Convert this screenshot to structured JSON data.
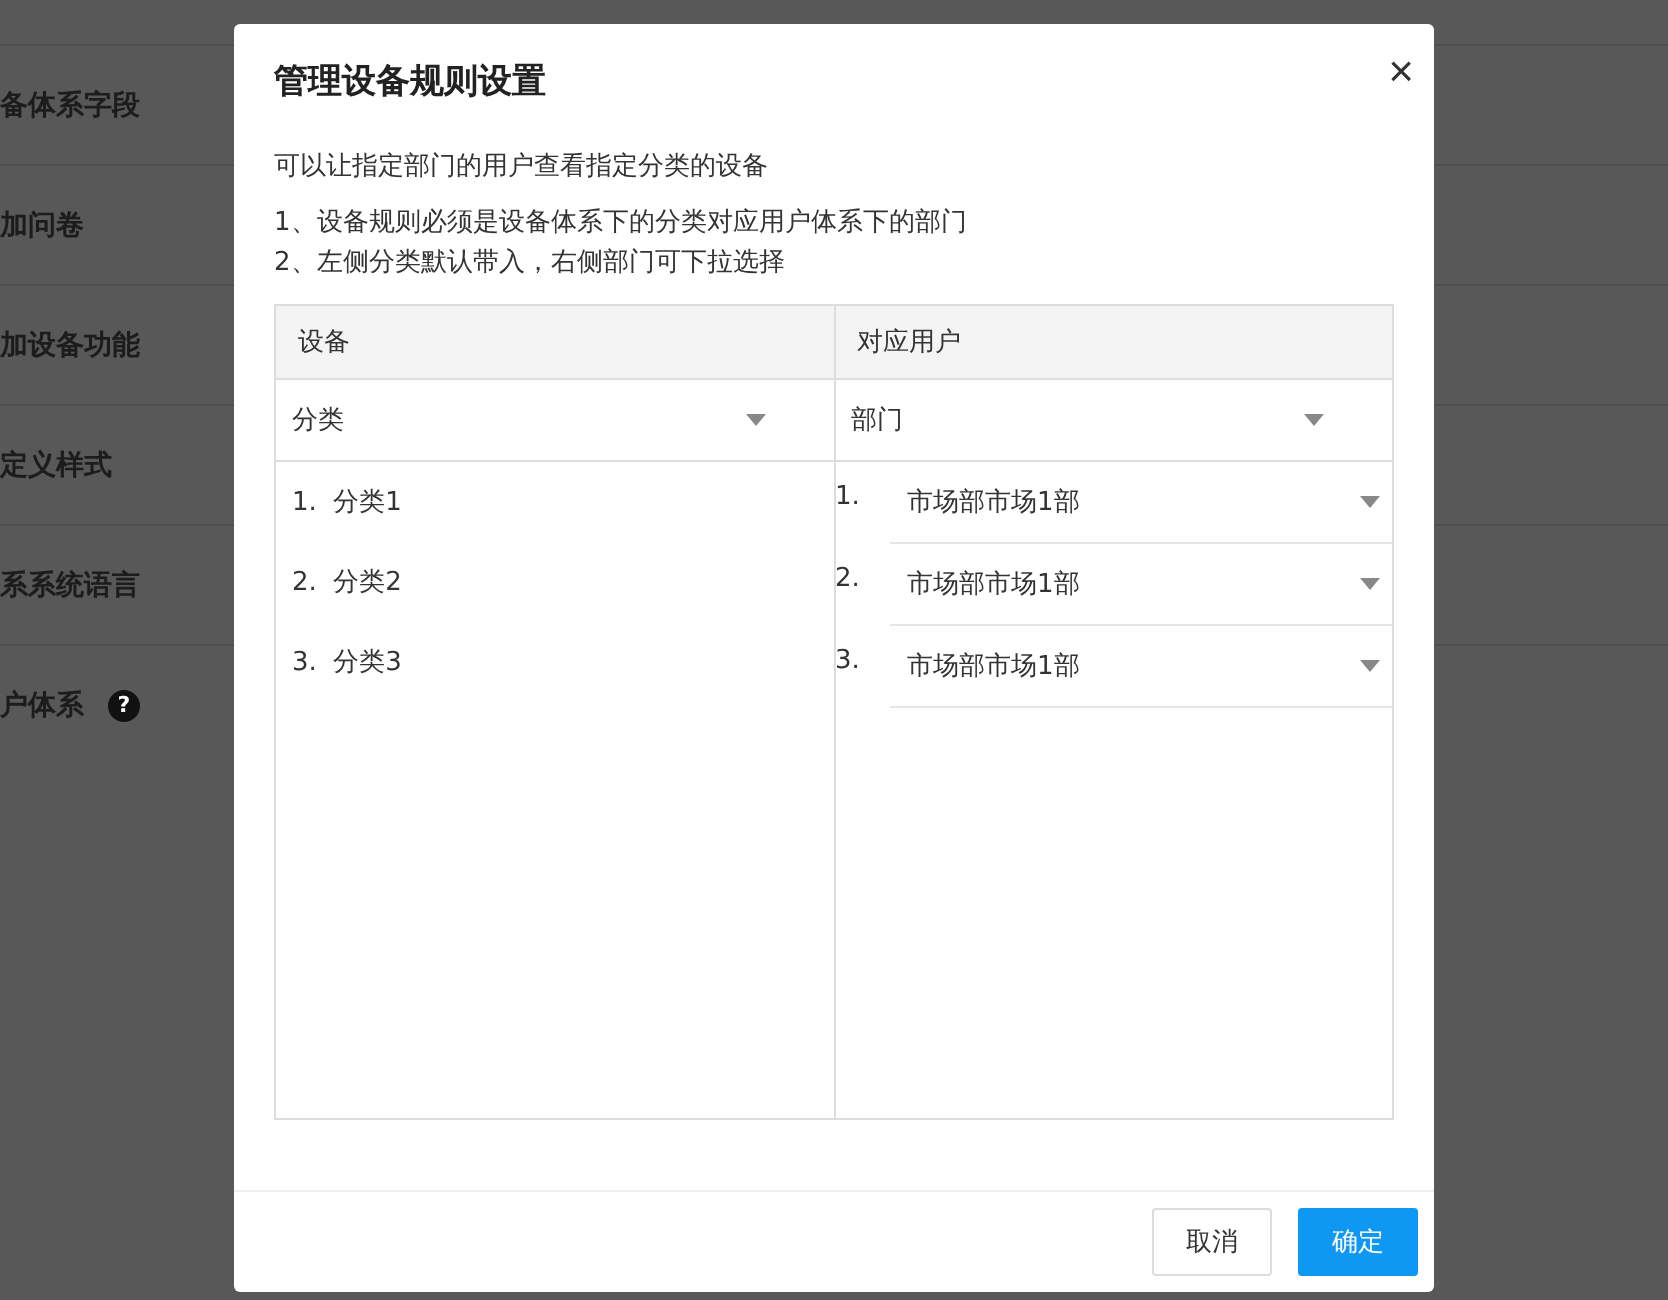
{
  "background": {
    "rows": [
      {
        "label": "备体系字段"
      },
      {
        "label": "加问卷"
      },
      {
        "label": "加设备功能"
      },
      {
        "label": "定义样式"
      },
      {
        "label": "系系统语言"
      },
      {
        "label": "户体系",
        "help_mark": "?"
      }
    ]
  },
  "dialog": {
    "title": "管理设备规则设置",
    "close": "×",
    "intro": "可以让指定部门的用户查看指定分类的设备",
    "notes": [
      "1、设备规则必须是设备体系下的分类对应用户体系下的部门",
      "2、左侧分类默认带入，右侧部门可下拉选择"
    ],
    "table": {
      "columns": [
        {
          "header": "设备",
          "select": "分类",
          "items": [
            {
              "number": "1.",
              "label": "分类1"
            },
            {
              "number": "2.",
              "label": "分类2"
            },
            {
              "number": "3.",
              "label": "分类3"
            }
          ],
          "kind": "list"
        },
        {
          "header": "对应用户",
          "select": "部门",
          "items": [
            {
              "number": "1.",
              "label": "市场部市场1部"
            },
            {
              "number": "2.",
              "label": "市场部市场1部"
            },
            {
              "number": "3.",
              "label": "市场部市场1部"
            }
          ],
          "kind": "selects"
        }
      ]
    },
    "buttons": [
      {
        "label": "取消",
        "kind": "secondary"
      },
      {
        "label": "确定",
        "kind": "primary"
      }
    ]
  }
}
